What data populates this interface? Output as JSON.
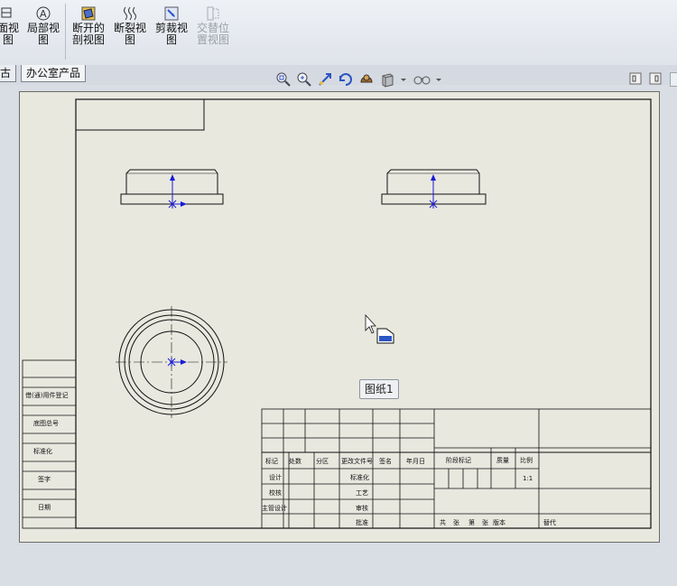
{
  "ribbon": {
    "buttons": [
      {
        "id": "section",
        "line1": "面视",
        "line2": "图",
        "disabled": false
      },
      {
        "id": "detail",
        "line1": "局部视",
        "line2": "图",
        "disabled": false
      },
      {
        "id": "broken_out",
        "line1": "断开的",
        "line2": "剖视图",
        "disabled": false
      },
      {
        "id": "break",
        "line1": "断裂视",
        "line2": "图",
        "disabled": false
      },
      {
        "id": "crop",
        "line1": "剪裁视",
        "line2": "图",
        "disabled": false
      },
      {
        "id": "alt_position",
        "line1": "交替位",
        "line2": "置视图",
        "disabled": true
      }
    ]
  },
  "tabs": [
    {
      "label": "古",
      "active": false
    },
    {
      "label": "办公室产品",
      "active": true
    }
  ],
  "view_toolbar": {
    "icons": [
      "zoom-fit-icon",
      "zoom-area-icon",
      "previous-view-icon",
      "rotate-icon",
      "shaded-icon",
      "display-style-icon",
      "hide-show-icon"
    ]
  },
  "sheet": {
    "tooltip": "图纸1",
    "left_column": [
      "借(通)用件登记",
      "底图总号",
      "标准化",
      "签字",
      "日期"
    ],
    "title_block_labels": {
      "row1": [
        "标记",
        "处数",
        "分区",
        "更改文件号",
        "签名",
        "年月日"
      ],
      "row2": [
        "设计",
        "标准化"
      ],
      "row3": [
        "校核",
        "工艺"
      ],
      "row4": [
        "主管设计",
        "审核"
      ],
      "row5": [
        "批准"
      ],
      "right_headers": [
        "阶段标记",
        "质量",
        "比例"
      ],
      "scale": "1:1",
      "sheet_info": [
        "共",
        "张",
        "第",
        "张",
        "版本",
        "替代"
      ]
    }
  },
  "colors": {
    "sheet_bg": "#e8e8df",
    "line": "#111111",
    "axis": "#1a1ad6"
  }
}
